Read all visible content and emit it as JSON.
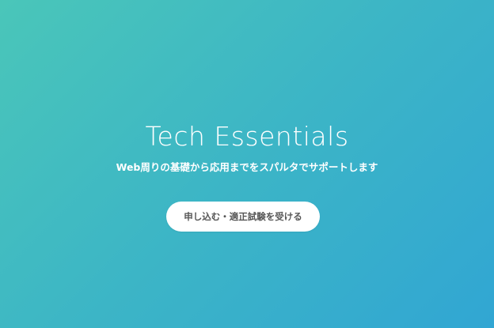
{
  "hero": {
    "title": "Tech Essentials",
    "subtitle": "Web周りの基礎から応用までをスパルタでサポートします",
    "cta_label": "申し込む・適正試験を受ける"
  },
  "colors": {
    "gradient_start": "#4ac6b9",
    "gradient_end": "#31a6d3",
    "text_primary": "#ffffff",
    "button_bg": "#ffffff",
    "button_text": "#555555"
  }
}
